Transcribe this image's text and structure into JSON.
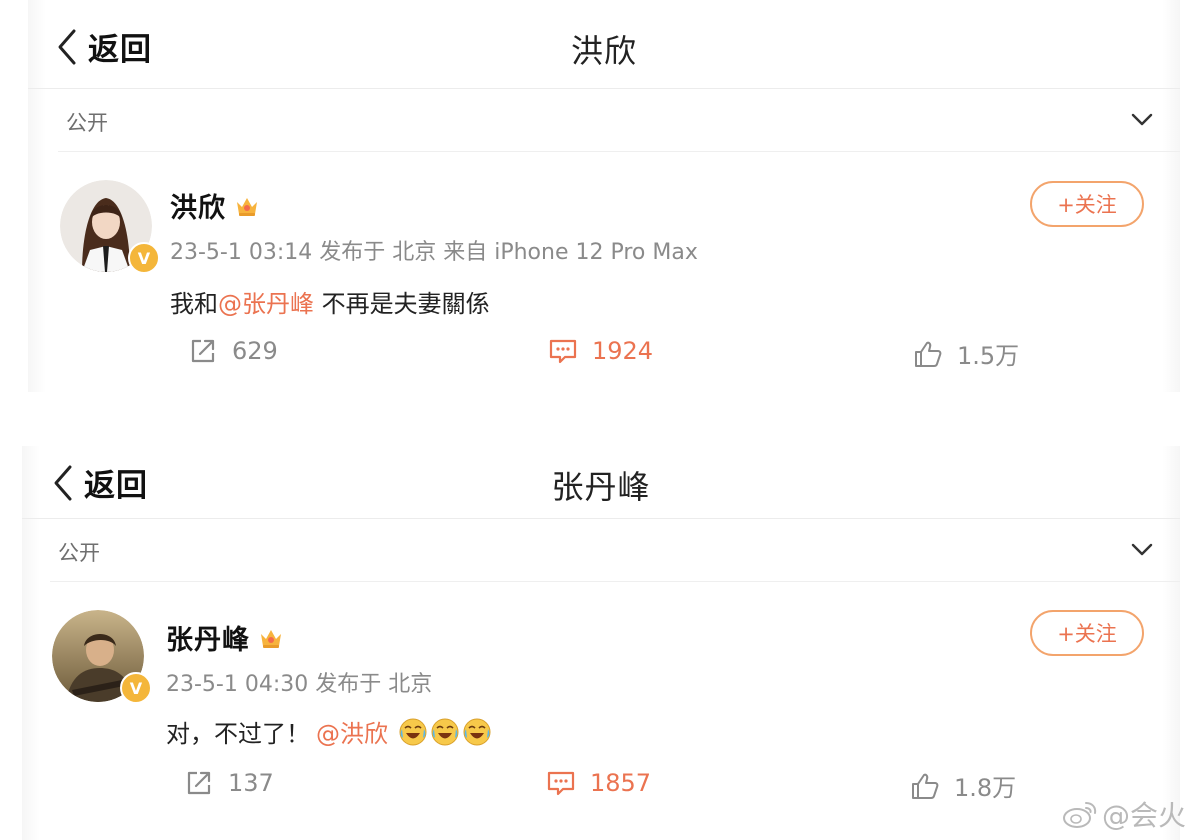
{
  "icons": {
    "back": "chevron-left-icon",
    "expand": "chevron-down-icon",
    "repost": "repost-icon",
    "comment": "comment-icon",
    "like": "thumbs-up-icon",
    "verified": "verified-badge-icon",
    "crown": "crown-icon",
    "emoji": "laugh-cry-emoji-icon",
    "weibo": "weibo-logo-icon"
  },
  "colors": {
    "accent": "#eb7350",
    "follow_border": "#f3a46c",
    "meta_text": "#8a8a8a",
    "verified_badge": "#f4b63a"
  },
  "screens": [
    {
      "back_label": "返回",
      "nav_title": "洪欣",
      "visibility": "公开",
      "post": {
        "author": "洪欣",
        "meta": "23-5-1 03:14 发布于 北京 来自 iPhone 12 Pro Max",
        "text_before": "我和",
        "mention": "@张丹峰",
        "text_after": " 不再是夫妻關係",
        "follow_label": "+关注",
        "reposts": "629",
        "comments": "1924",
        "likes": "1.5万"
      }
    },
    {
      "back_label": "返回",
      "nav_title": "张丹峰",
      "visibility": "公开",
      "post": {
        "author": "张丹峰",
        "meta": "23-5-1 04:30 发布于 北京",
        "text_before": "对，不过了！",
        "mention": "@洪欣",
        "emoji_count": 3,
        "follow_label": "+关注",
        "reposts": "137",
        "comments": "1857",
        "likes": "1.8万"
      }
    }
  ],
  "watermark": "@会火",
  "vbadge_text": "V"
}
